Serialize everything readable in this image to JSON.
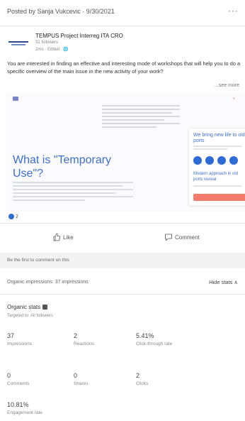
{
  "header": {
    "posted_by": "Posted by Sanja Vukcevic · 9/30/2021",
    "more_label": "···"
  },
  "author": {
    "name": "TEMPUS Project Interreg ITA CRO",
    "followers": "31 followers",
    "meta": "2mo · Edited · 🌐"
  },
  "post": {
    "text": "You are interested in finding an effective and interesting mode of workshops that will help you to do a specific overview of the main issue in the new activity of your work?",
    "see_more": "...see more"
  },
  "media": {
    "title": "What is \"Temporary Use\"?",
    "card_title": "We bring new life to old ports",
    "card_subtitle": "Modern approach in old ports revival"
  },
  "reactions": {
    "count": "2"
  },
  "actions": {
    "like": "Like",
    "comment": "Comment"
  },
  "comments": {
    "first_comment": "Be the first to comment on this"
  },
  "impressions": {
    "label": "Organic impressions: 37 impressions",
    "hide_stats": "Hide stats ∧"
  },
  "stats": {
    "title": "Organic stats",
    "subtitle": "Targeted to: All followers",
    "items": [
      {
        "value": "37",
        "label": "Impressions"
      },
      {
        "value": "2",
        "label": "Reactions"
      },
      {
        "value": "5.41%",
        "label": "Click-through rate"
      },
      {
        "value": "0",
        "label": "Comments"
      },
      {
        "value": "0",
        "label": "Shares"
      },
      {
        "value": "2",
        "label": "Clicks"
      },
      {
        "value": "10.81%",
        "label": "Engagement rate"
      }
    ]
  },
  "colors": {
    "accent": "#3d6fd0",
    "cta": "#f57c6b"
  }
}
